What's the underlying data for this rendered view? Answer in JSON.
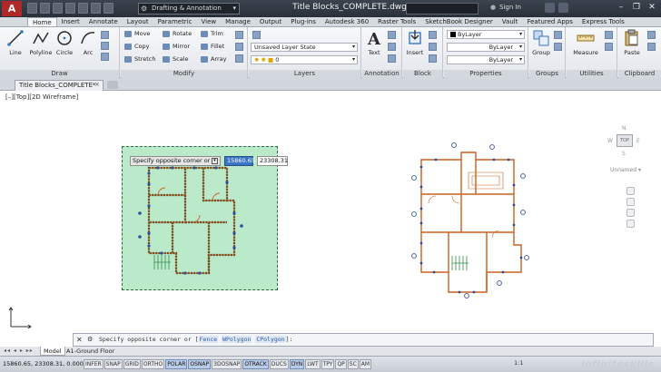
{
  "title_bar": {
    "app_logo": "A",
    "workspace": "Drafting & Annotation",
    "document_title": "Title Blocks_COMPLETE.dwg",
    "signin": "Sign In",
    "window_controls": [
      "–",
      "❐",
      "✕"
    ]
  },
  "ribbon_tabs": [
    "Home",
    "Insert",
    "Annotate",
    "Layout",
    "Parametric",
    "View",
    "Manage",
    "Output",
    "Plug-ins",
    "Autodesk 360",
    "Raster Tools",
    "SketchBook Designer",
    "Vault",
    "Featured Apps",
    "Express Tools"
  ],
  "ribbon": {
    "draw": {
      "title": "Draw",
      "buttons": [
        "Line",
        "Polyline",
        "Circle",
        "Arc"
      ]
    },
    "modify": {
      "title": "Modify",
      "rows": [
        [
          "Move",
          "Rotate",
          "Trim"
        ],
        [
          "Copy",
          "Mirror",
          "Fillet"
        ],
        [
          "Stretch",
          "Scale",
          "Array"
        ]
      ]
    },
    "layers": {
      "title": "Layers",
      "layer_state": "Unsaved Layer State",
      "current_layer": "0"
    },
    "annotation": {
      "title": "Annotation",
      "text_label": "Text"
    },
    "block": {
      "title": "Block",
      "insert_label": "Insert"
    },
    "properties": {
      "title": "Properties",
      "color": "ByLayer",
      "linetype": "ByLayer",
      "lineweight": "ByLayer"
    },
    "groups": {
      "title": "Groups",
      "group_label": "Group"
    },
    "utilities": {
      "title": "Utilities",
      "measure_label": "Measure"
    },
    "clipboard": {
      "title": "Clipboard",
      "paste_label": "Paste"
    }
  },
  "doc_tab": {
    "label": "Title Blocks_COMPLETE*",
    "close": "×"
  },
  "viewport": {
    "label": "[–][Top][2D Wireframe]",
    "prompt": "Specify opposite corner or",
    "coord_x": "15860.65",
    "coord_y": "23308.31",
    "viewcube": {
      "face": "TOP",
      "n": "N",
      "s": "S",
      "w": "W",
      "e": "E"
    },
    "ucs_name": "Unnamed ▾"
  },
  "command_line": {
    "prefix": "Specify opposite corner or [",
    "options": [
      "Fence",
      "WPolygon",
      "CPolygon"
    ],
    "suffix": "]:"
  },
  "layout_tabs": [
    "Model",
    "A1-Ground Floor"
  ],
  "status_bar": {
    "coordinates": "15860.65, 23308.31, 0.0000",
    "toggles": [
      "INFER",
      "SNAP",
      "GRID",
      "ORTHO",
      "POLAR",
      "OSNAP",
      "3DOSNAP",
      "OTRACK",
      "DUCS",
      "DYN",
      "LWT",
      "TPY",
      "QP",
      "SC",
      "AM"
    ],
    "active_toggles": [
      "POLAR",
      "OSNAP",
      "OTRACK",
      "DYN"
    ],
    "scale": "1:1",
    "watermark": "infiniteskills"
  },
  "colors": {
    "selection_fill": "#78d696",
    "plan_walls_orange": "#c8601e",
    "plan_walls_blue": "#2f4e9e",
    "accent_blue": "#3a76c5"
  }
}
